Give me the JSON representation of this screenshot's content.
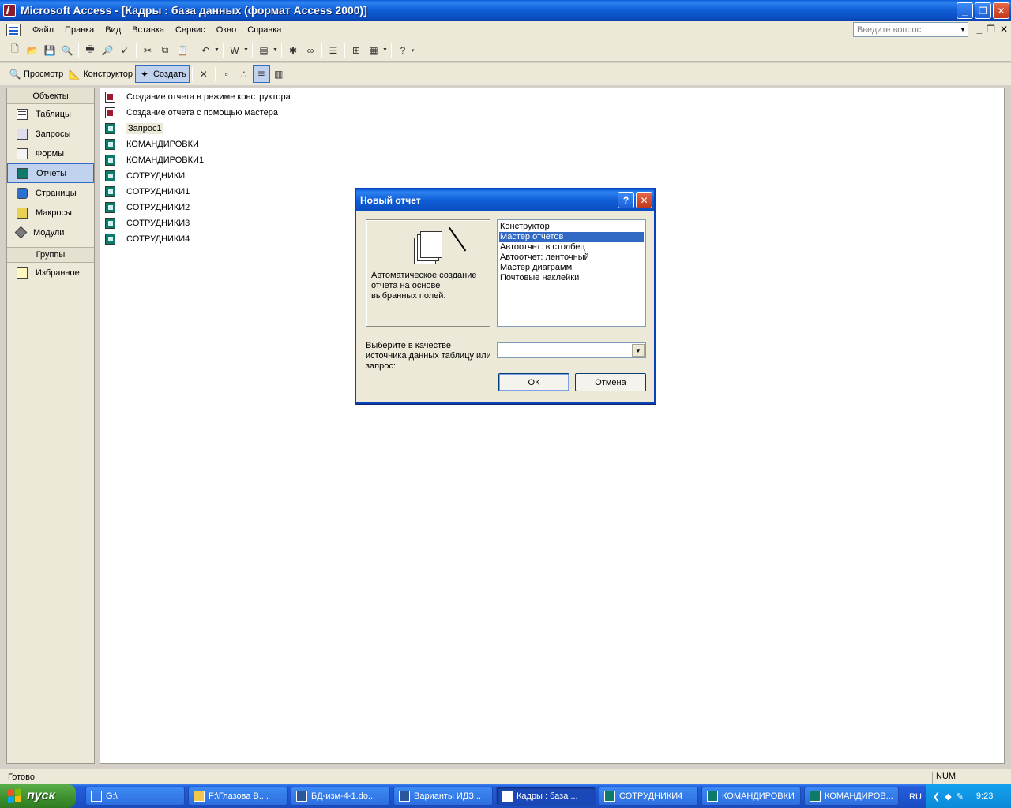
{
  "window": {
    "title": "Microsoft Access - [Кадры : база данных (формат Access 2000)]"
  },
  "menu": {
    "items": [
      "Файл",
      "Правка",
      "Вид",
      "Вставка",
      "Сервис",
      "Окно",
      "Справка"
    ],
    "help_placeholder": "Введите вопрос"
  },
  "dbtoolbar": {
    "preview": "Просмотр",
    "design": "Конструктор",
    "create": "Создать"
  },
  "objects": {
    "header": "Объекты",
    "items": [
      {
        "label": "Таблицы",
        "icon": "table-icon"
      },
      {
        "label": "Запросы",
        "icon": "query-icon"
      },
      {
        "label": "Формы",
        "icon": "form-icon"
      },
      {
        "label": "Отчеты",
        "icon": "report-icon"
      },
      {
        "label": "Страницы",
        "icon": "page-icon"
      },
      {
        "label": "Макросы",
        "icon": "macro-icon"
      },
      {
        "label": "Модули",
        "icon": "module-icon"
      }
    ],
    "groups_header": "Группы",
    "groups": [
      {
        "label": "Избранное",
        "icon": "favorites-icon"
      }
    ]
  },
  "list": {
    "items": [
      {
        "label": "Создание отчета в режиме конструктора",
        "icon": "new-report-icon"
      },
      {
        "label": "Создание отчета с помощью мастера",
        "icon": "new-report-icon"
      },
      {
        "label": "Запрос1",
        "icon": "report-icon"
      },
      {
        "label": "КОМАНДИРОВКИ",
        "icon": "report-icon"
      },
      {
        "label": "КОМАНДИРОВКИ1",
        "icon": "report-icon"
      },
      {
        "label": "СОТРУДНИКИ",
        "icon": "report-icon"
      },
      {
        "label": "СОТРУДНИКИ1",
        "icon": "report-icon"
      },
      {
        "label": "СОТРУДНИКИ2",
        "icon": "report-icon"
      },
      {
        "label": "СОТРУДНИКИ3",
        "icon": "report-icon"
      },
      {
        "label": "СОТРУДНИКИ4",
        "icon": "report-icon"
      }
    ]
  },
  "dialog": {
    "title": "Новый отчет",
    "description": "Автоматическое создание отчета на основе выбранных полей.",
    "options": [
      "Конструктор",
      "Мастер отчетов",
      "Автоотчет: в столбец",
      "Автоотчет: ленточный",
      "Мастер диаграмм",
      "Почтовые наклейки"
    ],
    "selected_option": "Мастер отчетов",
    "source_label": "Выберите в качестве источника данных таблицу или запрос:",
    "source_value": "",
    "ok": "ОК",
    "cancel": "Отмена"
  },
  "status": {
    "text": "Готово",
    "num": "NUM"
  },
  "taskbar": {
    "start": "пуск",
    "tasks": [
      {
        "label": "G:\\",
        "active": false
      },
      {
        "label": "F:\\Глазова В....",
        "active": false
      },
      {
        "label": "БД-изм-4-1.do...",
        "active": false
      },
      {
        "label": "Варианты ИДЗ...",
        "active": false
      },
      {
        "label": "Кадры : база ...",
        "active": true
      },
      {
        "label": "СОТРУДНИКИ4",
        "active": false
      },
      {
        "label": "КОМАНДИРОВКИ",
        "active": false
      },
      {
        "label": "КОМАНДИРОВ...",
        "active": false
      }
    ],
    "lang": "RU",
    "clock": "9:23"
  },
  "colors": {
    "title_blue": "#0a5fdc",
    "selection": "#316ac5",
    "start_green": "#3c8f2c"
  }
}
